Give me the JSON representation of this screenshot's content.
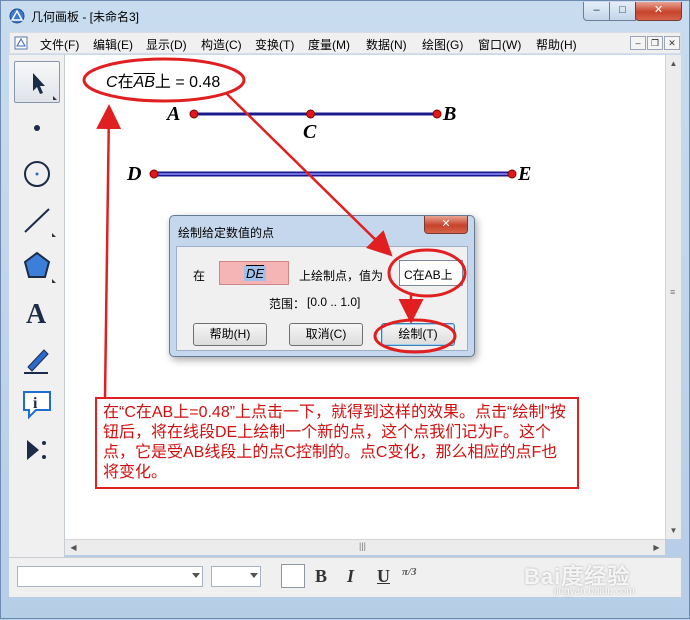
{
  "window": {
    "title": "几何画板 - [未命名3]",
    "min_label": "–",
    "max_label": "□",
    "close_label": "✕"
  },
  "menu": {
    "items": [
      "文件(F)",
      "编辑(E)",
      "显示(D)",
      "构造(C)",
      "变换(T)",
      "度量(M)",
      "数据(N)",
      "绘图(G)",
      "窗口(W)",
      "帮助(H)"
    ],
    "mdi_min": "–",
    "mdi_restore": "❐",
    "mdi_close": "✕"
  },
  "toolbar": {
    "tools": [
      "arrow-select",
      "point",
      "compass-circle",
      "straightedge",
      "polygon",
      "text",
      "marker",
      "information",
      "custom-tool"
    ]
  },
  "canvas": {
    "measurement": {
      "prefix": "C",
      "mid": "在",
      "segment": "AB",
      "suffix": "上 = 0.48"
    },
    "points": {
      "A": "A",
      "B": "B",
      "C": "C",
      "D": "D",
      "E": "E"
    },
    "ab_value": 0.48
  },
  "dialog": {
    "title": "绘制给定数值的点",
    "close_label": "✕",
    "on_label": "在",
    "segment_value": "DE",
    "draw_on_label": "上绘制点，值为",
    "value_field": "C在AB上",
    "range_label": "范围：",
    "range_value": "[0.0 .. 1.0]",
    "help_button": "帮助(H)",
    "cancel_button": "取消(C)",
    "draw_button": "绘制(T)"
  },
  "note": {
    "text": "在“C在AB上=0.48”上点击一下，就得到这样的效果。点击“绘制”按钮后，将在线段DE上绘制一个新的点，这个点我们记为F。这个点，它是受AB线段上的点C控制的。点C变化，那么相应的点F也将变化。"
  },
  "statusbar": {
    "bold": "B",
    "italic": "I",
    "underline": "U",
    "measure_symbol": "π/3"
  },
  "watermark": {
    "brand": "Bai度经验",
    "sub": "jingyan.baidu.com"
  },
  "colors": {
    "annotation_red": "#e02020",
    "segment_blue": "#1a1a8c",
    "point_red": "#e01818",
    "segment_de_inner": "#9090ff"
  }
}
